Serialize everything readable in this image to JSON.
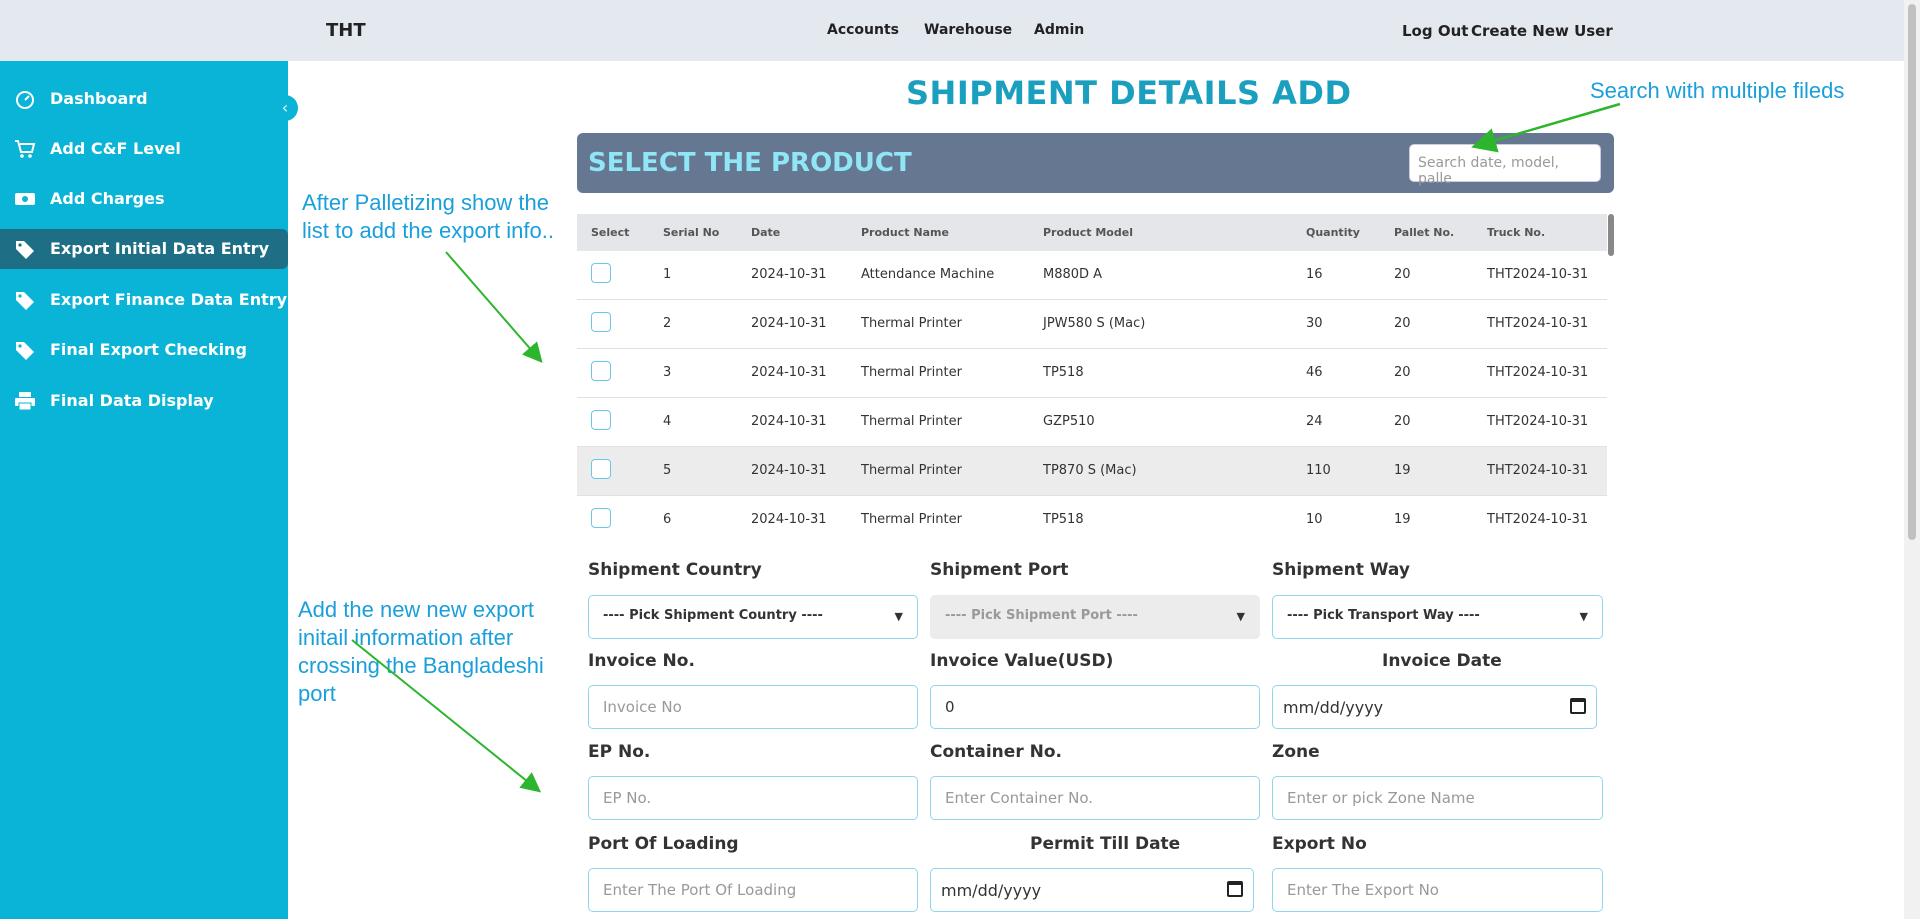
{
  "header": {
    "brand": "THT",
    "nav": [
      "Accounts",
      "Warehouse",
      "Admin"
    ],
    "logout": "Log Out",
    "create_user": "Create New User"
  },
  "sidebar": {
    "items": [
      {
        "label": "Dashboard",
        "icon": "gauge-icon"
      },
      {
        "label": "Add C&F Level",
        "icon": "cart-icon"
      },
      {
        "label": "Add Charges",
        "icon": "money-icon"
      },
      {
        "label": "Export Initial Data Entry",
        "icon": "tag-icon",
        "active": true
      },
      {
        "label": "Export Finance Data Entry",
        "icon": "tag-icon"
      },
      {
        "label": "Final Export Checking",
        "icon": "tag-icon"
      },
      {
        "label": "Final Data Display",
        "icon": "printer-icon"
      }
    ],
    "collapse": "‹"
  },
  "annotations": {
    "search_note": "Search with multiple fileds",
    "list_note_1": "After Palletizing show the",
    "list_note_2": "list to add the export info..",
    "form_note_1": "Add the new new export",
    "form_note_2": "initail information after",
    "form_note_3": "crossing the Bangladeshi",
    "form_note_4": "port",
    "arrow_color": "#2db52d"
  },
  "page": {
    "title": "SHIPMENT DETAILS ADD"
  },
  "product": {
    "section_title": "SELECT THE PRODUCT",
    "search_placeholder": "Search date, model, palle",
    "columns": [
      "Select",
      "Serial No",
      "Date",
      "Product Name",
      "Product Model",
      "Quantity",
      "Pallet No.",
      "Truck No."
    ],
    "rows": [
      [
        "1",
        "2024-10-31",
        "Attendance Machine",
        "M880D A",
        "16",
        "20",
        "THT2024-10-31"
      ],
      [
        "2",
        "2024-10-31",
        "Thermal Printer",
        "JPW580 S (Mac)",
        "30",
        "20",
        "THT2024-10-31"
      ],
      [
        "3",
        "2024-10-31",
        "Thermal Printer",
        "TP518",
        "46",
        "20",
        "THT2024-10-31"
      ],
      [
        "4",
        "2024-10-31",
        "Thermal Printer",
        "GZP510",
        "24",
        "20",
        "THT2024-10-31"
      ],
      [
        "5",
        "2024-10-31",
        "Thermal Printer",
        "TP870 S (Mac)",
        "110",
        "19",
        "THT2024-10-31"
      ],
      [
        "6",
        "2024-10-31",
        "Thermal Printer",
        "TP518",
        "10",
        "19",
        "THT2024-10-31"
      ]
    ]
  },
  "form": {
    "shipment_country_label": "Shipment Country",
    "shipment_country_value": "---- Pick Shipment Country ----",
    "shipment_port_label": "Shipment Port",
    "shipment_port_value": "---- Pick Shipment Port ----",
    "shipment_way_label": "Shipment Way",
    "shipment_way_value": "---- Pick Transport Way ----",
    "invoice_no_label": "Invoice No.",
    "invoice_no_placeholder": "Invoice No",
    "invoice_value_label": "Invoice Value(USD)",
    "invoice_value": "0",
    "invoice_date_label": "Invoice Date",
    "invoice_date_value": "mm/dd/yyyy",
    "ep_no_label": "EP No.",
    "ep_no_placeholder": "EP No.",
    "container_label": "Container No.",
    "container_placeholder": "Enter Container No.",
    "zone_label": "Zone",
    "zone_placeholder": "Enter or pick Zone Name",
    "port_loading_label": "Port Of Loading",
    "port_loading_placeholder": "Enter The Port Of Loading",
    "permit_label": "Permit Till Date",
    "permit_value": "mm/dd/yyyy",
    "export_no_label": "Export No",
    "export_no_placeholder": "Enter The Export No"
  }
}
